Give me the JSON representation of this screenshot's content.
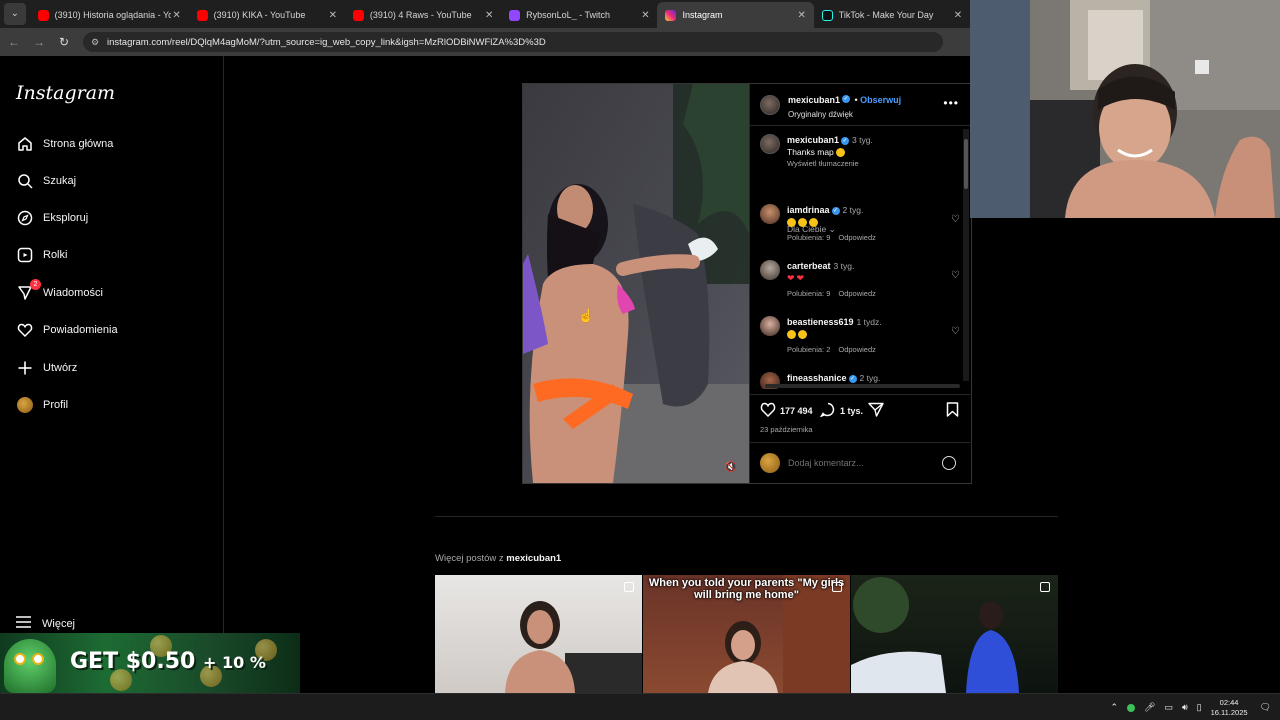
{
  "browser": {
    "tabs": [
      {
        "title": "(3910) Historia oglądania - You",
        "icon_color": "#ff0000",
        "active": false
      },
      {
        "title": "(3910) KIKA - YouTube",
        "icon_color": "#ff0000",
        "active": false
      },
      {
        "title": "(3910) 4 Raws - YouTube",
        "icon_color": "#ff0000",
        "active": false
      },
      {
        "title": "RybsonLoL_ - Twitch",
        "icon_color": "#9146ff",
        "active": false
      },
      {
        "title": "Instagram",
        "icon_color": "#e1306c",
        "active": true
      },
      {
        "title": "TikTok - Make Your Day",
        "icon_color": "#111111",
        "active": false
      }
    ],
    "url": "instagram.com/reel/DQlqM4agMoM/?utm_source=ig_web_copy_link&igsh=MzRlODBiNWFlZA%3D%3D"
  },
  "sidebar": {
    "logo": "Instagram",
    "items": [
      {
        "label": "Strona główna",
        "icon": "home-icon"
      },
      {
        "label": "Szukaj",
        "icon": "search-icon"
      },
      {
        "label": "Eksploruj",
        "icon": "compass-icon"
      },
      {
        "label": "Rolki",
        "icon": "reels-icon"
      },
      {
        "label": "Wiadomości",
        "icon": "messenger-icon",
        "badge": "2"
      },
      {
        "label": "Powiadomienia",
        "icon": "heart-icon"
      },
      {
        "label": "Utwórz",
        "icon": "plus-icon"
      },
      {
        "label": "Profil",
        "icon": "avatar"
      }
    ],
    "more": "Więcej"
  },
  "post": {
    "author": "mexicuban1",
    "follow": "Obserwuj",
    "sound": "Oryginalny dźwięk",
    "comments": [
      {
        "user": "mexicuban1",
        "time": "3 tyg.",
        "text": "Thanks map",
        "translate": "Wyświetl tłumaczenie",
        "verified": true
      },
      {
        "user": "iamdrinaa",
        "time": "2 tyg.",
        "likes": "Polubienia: 9",
        "reply": "Odpowiedz",
        "verified": true
      },
      {
        "user": "carterbeat",
        "time": "3 tyg.",
        "likes": "Polubienia: 9",
        "reply": "Odpowiedz",
        "verified": false
      },
      {
        "user": "beastieness619",
        "time": "1 tydz.",
        "likes": "Polubienia: 2",
        "reply": "Odpowiedz",
        "verified": false
      },
      {
        "user": "fineasshanice",
        "time": "2 tyg.",
        "verified": true
      }
    ],
    "dla_ciebie": "Dla Ciebie",
    "like_count": "177 494",
    "comment_count": "1 tys.",
    "date": "23 października",
    "comment_placeholder": "Dodaj komentarz..."
  },
  "more_posts": {
    "prefix": "Więcej postów z",
    "user": "mexicuban1",
    "thumbs": [
      {
        "caption": ""
      },
      {
        "caption": "When you told your parents \"My girls will bring me home\""
      },
      {
        "caption": ""
      }
    ]
  },
  "ad": {
    "text": "GET $0.50",
    "bonus": "+ 10 %"
  },
  "taskbar": {
    "time": "02:44",
    "date": "16.11.2025"
  }
}
